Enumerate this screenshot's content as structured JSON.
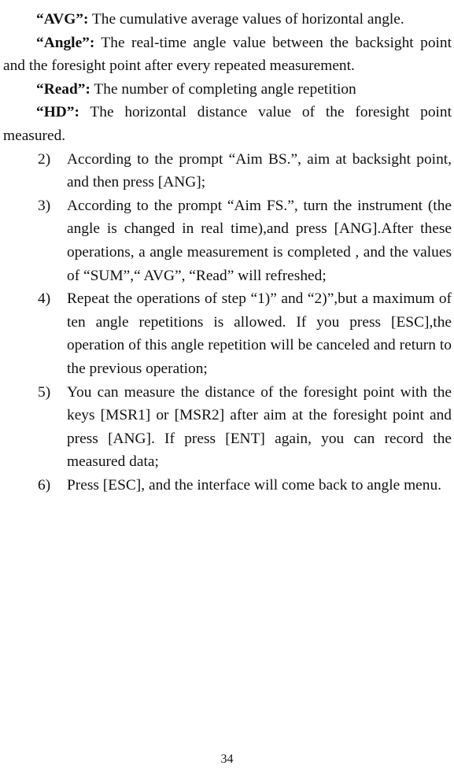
{
  "definitions": [
    {
      "term": "“AVG”:",
      "text": " The cumulative average values of horizontal angle."
    },
    {
      "term": "“Angle”:",
      "text": " The real-time angle value between the backsight point and the foresight point after every repeated measurement."
    },
    {
      "term": "“Read”:",
      "text": " The number of completing angle repetition"
    },
    {
      "term": "“HD”:",
      "text": " The horizontal distance value of the foresight point measured."
    }
  ],
  "steps": [
    {
      "num": "2)",
      "text": "According to the prompt “Aim BS.”, aim at backsight point, and then press [ANG];"
    },
    {
      "num": "3)",
      "text": "According to the prompt “Aim FS.”, turn the instrument (the angle is changed in real time),and press [ANG].After these operations, a angle measurement is completed , and the values of “SUM”,“ AVG”, “Read” will refreshed;"
    },
    {
      "num": "4)",
      "text": "Repeat the operations of step “1)” and “2)”,but a maximum of ten angle repetitions is allowed. If you press [ESC],the operation of this angle repetition will be canceled and return to the previous operation;"
    },
    {
      "num": "5)",
      "text": "You can measure the distance of the foresight point with the keys [MSR1] or [MSR2] after aim at the foresight point and press [ANG]. If press [ENT] again, you can record the measured data;"
    },
    {
      "num": "6)",
      "text": "Press [ESC], and the interface will come back to angle menu."
    }
  ],
  "page_number": "34"
}
